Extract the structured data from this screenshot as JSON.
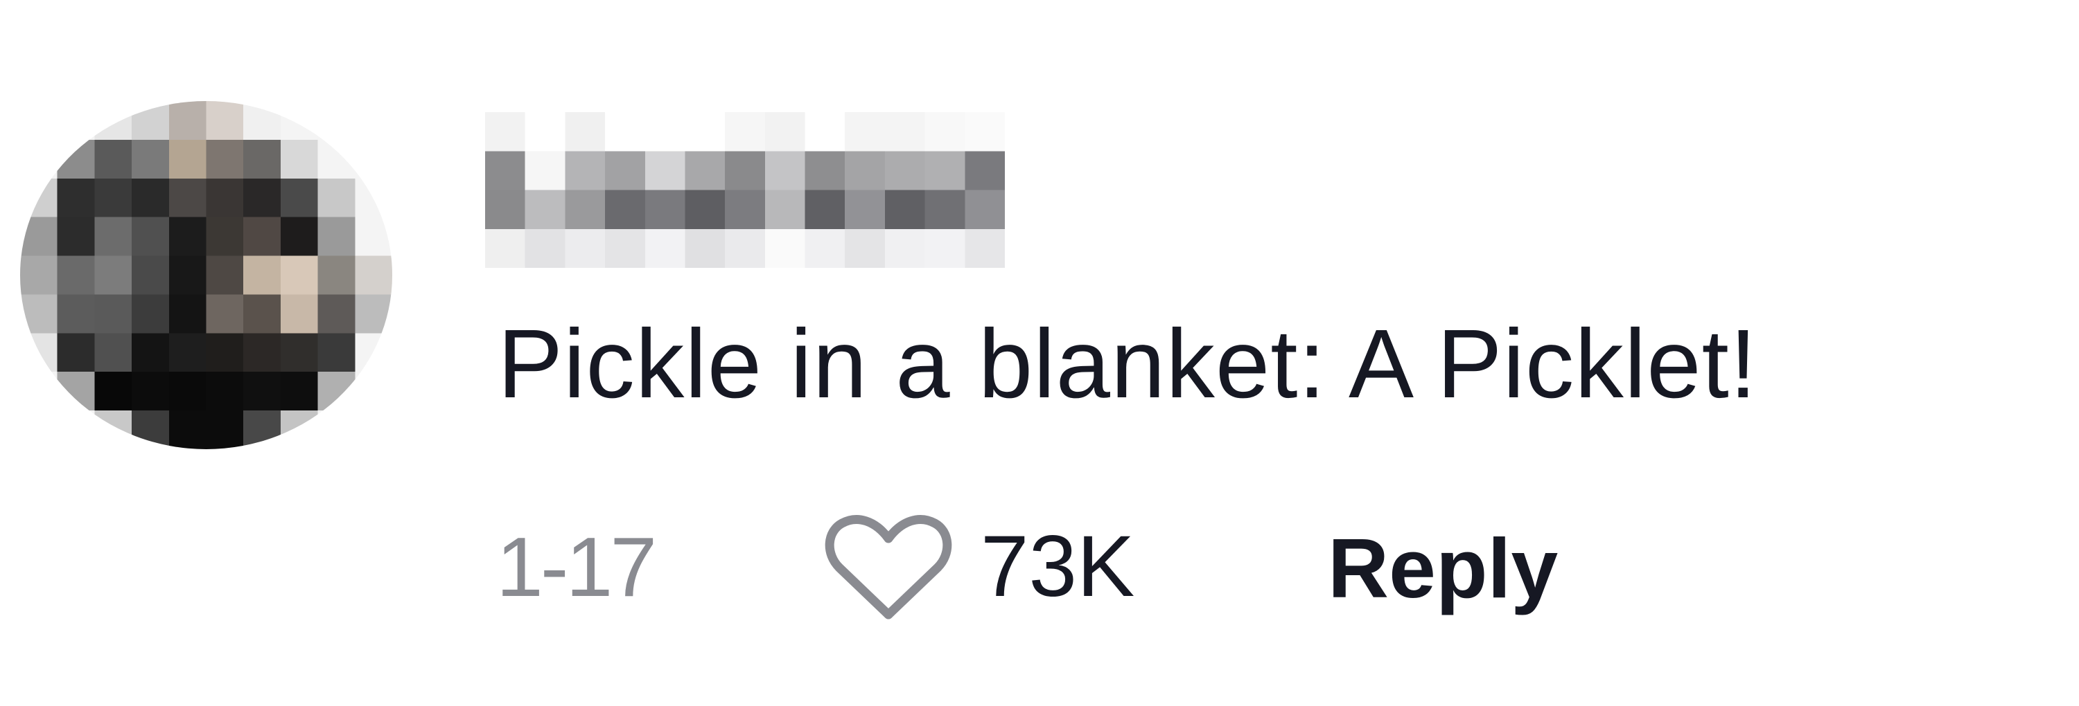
{
  "comment": {
    "text": "Pickle in a blanket: A Picklet!",
    "date": "1-17",
    "like_count": "73K",
    "reply_label": "Reply",
    "avatar_icon": "pixelated-avatar-icon",
    "like_icon": "heart-outline-icon"
  },
  "colors": {
    "text_primary": "#161823",
    "text_secondary": "#8a8b91",
    "icon_stroke": "#8a8b91",
    "background": "#ffffff"
  }
}
